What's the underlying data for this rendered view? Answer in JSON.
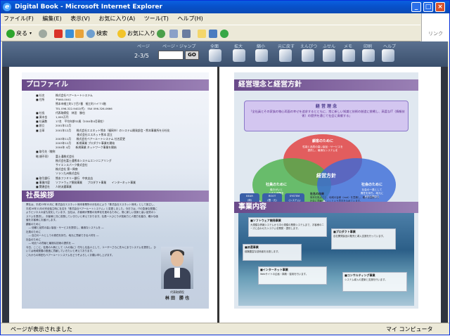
{
  "window": {
    "title": "Digital Book - Microsoft Internet Explorer",
    "min_label": "_",
    "max_label": "□",
    "close_label": "×"
  },
  "menu": [
    "ファイル(F)",
    "編集(E)",
    "表示(V)",
    "お気に入り(A)",
    "ツール(T)",
    "ヘルプ(H)"
  ],
  "brand": "リンク",
  "toolbar": {
    "back_label": "戻る",
    "search_label": "検索",
    "favorites_label": "お気に入り"
  },
  "viewer": {
    "labels": [
      "ページ",
      "ページ・ジャンプ",
      "全面",
      "拡大",
      "縮小",
      "元に戻す",
      "えんぴつ",
      "ふせん",
      "メモ",
      "印刷",
      "ヘルプ"
    ],
    "page_indicator": "2-3/5",
    "go_label": "GO"
  },
  "left_page": {
    "profile_title": "プロファイル",
    "profile_rows": [
      {
        "k": "■ 社名",
        "v": "株式会社ベアールートシステム"
      },
      {
        "k": "■ 住所",
        "v": "〒860-0041"
      },
      {
        "k": "",
        "v": "熊本市細工町1丁目7番　細工町ハイツ3階"
      },
      {
        "k": "",
        "v": "TEL 096-322-9402(代)　FAX 096-326-0666"
      },
      {
        "k": "■ 社長",
        "v": "代表取締役　林田　勝也"
      },
      {
        "k": "■ 資本金",
        "v": "1,000万円"
      },
      {
        "k": "■ 社員数",
        "v": "17名　平均年齢32歳（2004年4月現在）"
      },
      {
        "k": "■ 創立",
        "v": "2001年12月"
      },
      {
        "k": "■ 沿革",
        "v": "2001年12月　　株式会社エスネット熊本（福岡市）のシステム開発部会・熊本事業所を分社化"
      },
      {
        "k": "",
        "v": "　　　　　　　　株式会社エスネット熊本 設立"
      },
      {
        "k": "",
        "v": "2003年11月　　株式会社ベアールートシステム 社名変更"
      },
      {
        "k": "",
        "v": "2003年12月　　新規事業 プロダクト事業を開始"
      },
      {
        "k": "",
        "v": "2004年 4月　　新規事業 ネットワーク事業を開始"
      },
      {
        "k": "■ 取引先（敬称略 順不同）",
        "v": ""
      },
      {
        "k": "",
        "v": "富士通株式会社"
      },
      {
        "k": "",
        "v": "株式会社富士通熊本システムエンジニアリング"
      },
      {
        "k": "",
        "v": "サイエンスパーク株式会社"
      },
      {
        "k": "",
        "v": "株式会社 第一興商"
      },
      {
        "k": "",
        "v": "ソラン九州株式会社"
      },
      {
        "k": "■ 取引銀行",
        "v": "熊本ファミリー銀行　中央支店"
      },
      {
        "k": "■ 事業内容",
        "v": "ソフトウェア開発事業　　プロダクト事業　　インターネット事業"
      },
      {
        "k": "■ 関連会社",
        "v": "人材派遣事業"
      }
    ],
    "greeting_title": "社長挨拶",
    "greeting_text": "弊社は、平成13年12月に 株式会社エスネット熊本事業所の分社化により「株式会社エスネット熊本」として設立し、平成16年11月の完全独立時に社名を「株式会社ベアールートシステム」と変更しました。今日では、ITの急速な発展によりビジネスの姿も変化しています。当社は、お客様が業務の効率化を進めるために、常に新しい技術と高い品質のシステムを提供し、お客様と共に成長していきたいと考えております。社員一人ひとりが技術力と人間力を磨き、確かな価値をお客様にお届けします。\n顧客のために\n　― 信頼と品質の高い製品・サービスを提供し、最適なシステムを ―\n社員のために\n　― 自己の一人としての責任を持ち、地元に貢献できる人材を ―\n社会のために\n　― 地元への貢献と最適な技術の提供を ―\n今日、ここに、社員の人柄として（人の為に）付与し社会人として、ユーザーさらに先々にまでシステムを提供し、ひいては地域発展の推進に貢献していきたいと考えております。\nこれからの林田もベアールートシステムをどうぞよろしくお願い申し上げます。",
    "ceo_title": "代表取締役",
    "ceo_name": "林 田　勝 也"
  },
  "right_page": {
    "philosophy_title": "経営理念と経営方針",
    "box_title": "経 営 理 念",
    "box_text": "「全社員とその家族の物心両面の幸せを追求するとともに、常に新しい知識と技術の創造に挑戦し、高度なIT（情報技術）の提供を通じて社会に貢献する」",
    "circle_top": "顧客のために",
    "circle_top_sub": "性能と品質の高い製品・サービスを\n提供し、最適なシステムを",
    "circle_left": "社員のために",
    "circle_left_sub": "働きがいと\n公正な報酬を",
    "circle_right": "社会のために",
    "circle_right_sub": "社会の一員として\n責任を持ち、地元に\n良好な関係を",
    "center_label": "経営方針",
    "pills": [
      "BEAR\n(熊)",
      "ROOT\n(根・元)",
      "SYSTEM\n(システム)"
    ],
    "name_note_title": "社名の由来",
    "name_note_text": "熊本を拠点とし、地域の皆様（root）を意識し、確かな技術力で\n社会に貢献していくという意志を込めています。",
    "business_title": "事業内容",
    "business_boxes": [
      {
        "title": "■ソフトウェア開発事業",
        "text": "大規模な情報システムから中小規模の業務システムまで、お客様のニーズに合わせたシステムを開発・提供します。"
      },
      {
        "title": "■プロダクト事業",
        "text": "自社開発製品の販売と導入支援を行っています。"
      },
      {
        "title": "■派遣事業",
        "text": "経験豊富な技術者を派遣します。"
      },
      {
        "title": "■インターネット事業",
        "text": "Webサイトの企画・構築・運用を行います。"
      },
      {
        "title": "■コンサルティング事業",
        "text": "システム導入の提案と支援を行います。"
      }
    ]
  },
  "status": {
    "text": "ページが表示されました",
    "zone": "マイ コンピュータ"
  }
}
